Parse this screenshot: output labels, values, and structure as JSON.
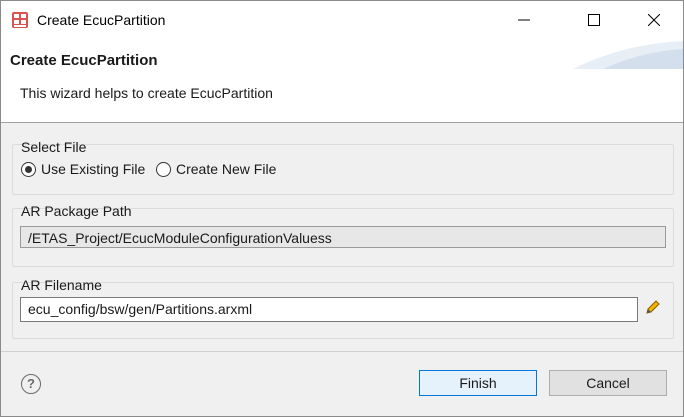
{
  "window": {
    "title": "Create EcucPartition",
    "icon": "ecu-partition-app-icon"
  },
  "titlebar_buttons": {
    "minimize": "minimize-icon",
    "maximize": "maximize-icon",
    "close": "close-icon"
  },
  "banner": {
    "title": "Create EcucPartition",
    "description": "This wizard helps to create EcucPartition"
  },
  "select_file": {
    "label": "Select File",
    "options": [
      {
        "label": "Use Existing File",
        "selected": true
      },
      {
        "label": "Create New File",
        "selected": false
      }
    ]
  },
  "ar_package": {
    "label": "AR Package Path",
    "value": "/ETAS_Project/EcucModuleConfigurationValuess"
  },
  "ar_filename": {
    "label": "AR Filename",
    "value": "ecu_config/bsw/gen/Partitions.arxml",
    "edit_icon": "pencil-icon"
  },
  "footer": {
    "help": "?",
    "finish_label": "Finish",
    "cancel_label": "Cancel"
  }
}
